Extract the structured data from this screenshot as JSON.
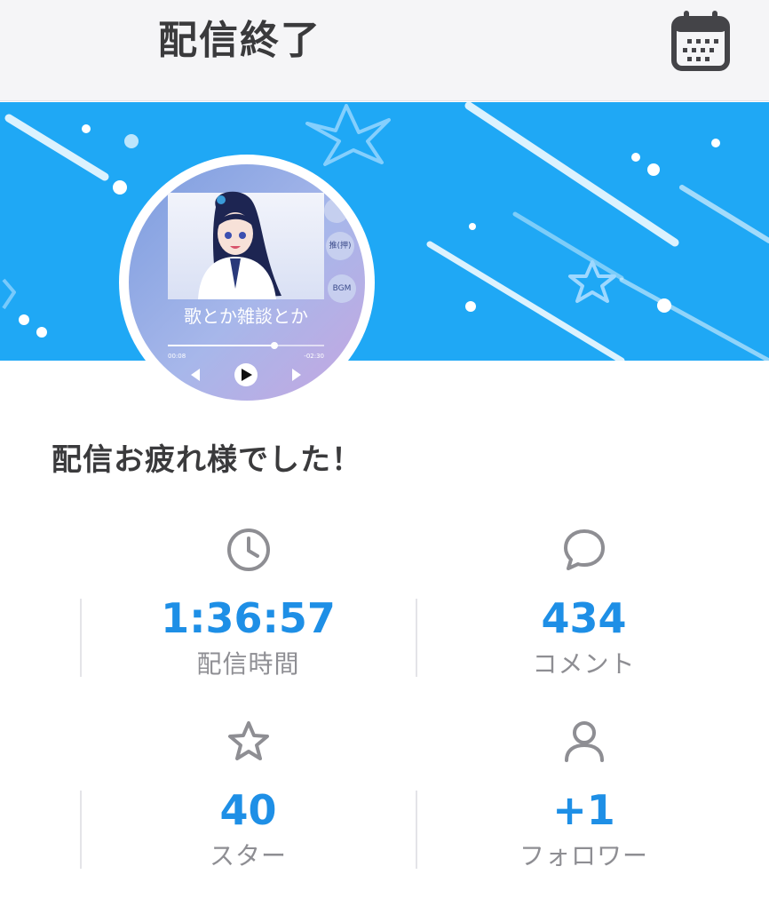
{
  "header": {
    "title": "配信終了",
    "calendar_icon": "calendar-icon"
  },
  "banner": {
    "background_color": "#1fa8f5",
    "thumbnail": {
      "caption": "歌とか雑談とか",
      "elapsed": "00:08",
      "remaining": "-02:30",
      "side_buttons": [
        "推(押)",
        "BGM"
      ]
    }
  },
  "message": "配信お疲れ様でした！",
  "stats": [
    {
      "icon": "clock-icon",
      "value": "1:36:57",
      "label": "配信時間"
    },
    {
      "icon": "comment-icon",
      "value": "434",
      "label": "コメント"
    },
    {
      "icon": "star-icon",
      "value": "40",
      "label": "スター"
    },
    {
      "icon": "person-icon",
      "value": "+1",
      "label": "フォロワー"
    }
  ],
  "colors": {
    "accent": "#1e8fe6",
    "label": "#8e8e93",
    "icon": "#8e8e93",
    "header_bg": "#f5f5f7"
  }
}
